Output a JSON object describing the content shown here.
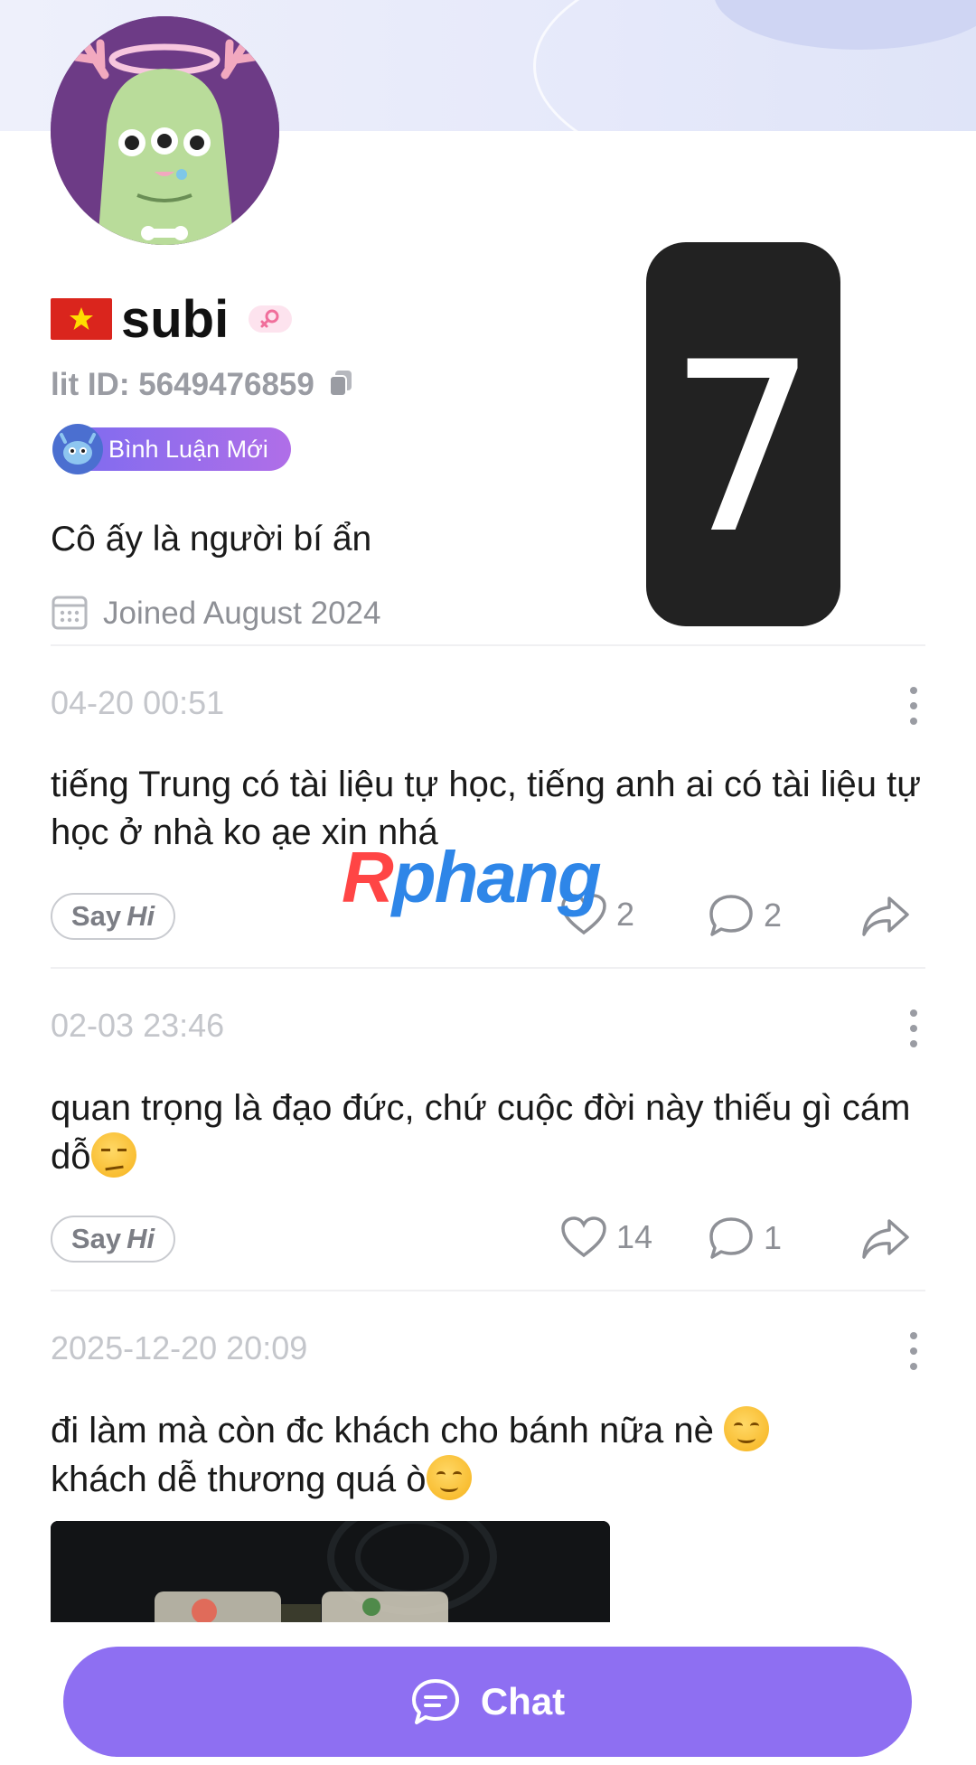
{
  "profile": {
    "username": "subi",
    "lit_id": "lit ID: 5649476859",
    "level_badge": "Bình Luận Mới",
    "bio": "Cô ấy là người bí ẩn",
    "joined": "Joined August 2024",
    "rank_number": "7",
    "flag_icon": "vietnam-flag-icon",
    "gender_icon": "female-icon"
  },
  "posts": [
    {
      "date": "04-20 00:51",
      "text": "tiếng Trung có tài liệu tự học, tiếng anh ai có tài liệu tự học ở nhà ko ạe xin nhá",
      "likes": "2",
      "comments": "2"
    },
    {
      "date": "02-03 23:46",
      "text": "quan trọng là đạo đức, chứ cuộc đời này thiếu gì cám dỗ",
      "likes": "14",
      "comments": "1"
    },
    {
      "date": "2025-12-20 20:09",
      "text_line1": "đi làm mà còn đc khách cho bánh nữa nè",
      "text_line2": "khách dễ thương quá ò"
    }
  ],
  "say_hi": {
    "say": "Say",
    "hi": "Hi"
  },
  "watermark": {
    "part1": "R",
    "part2": "phang"
  },
  "chat_button": {
    "label": "Chat"
  },
  "colors": {
    "accent": "#8e6ff2",
    "badge_gradient_start": "#7b6cf0",
    "badge_gradient_end": "#b06ee8",
    "muted_text": "#c4c6cb"
  }
}
